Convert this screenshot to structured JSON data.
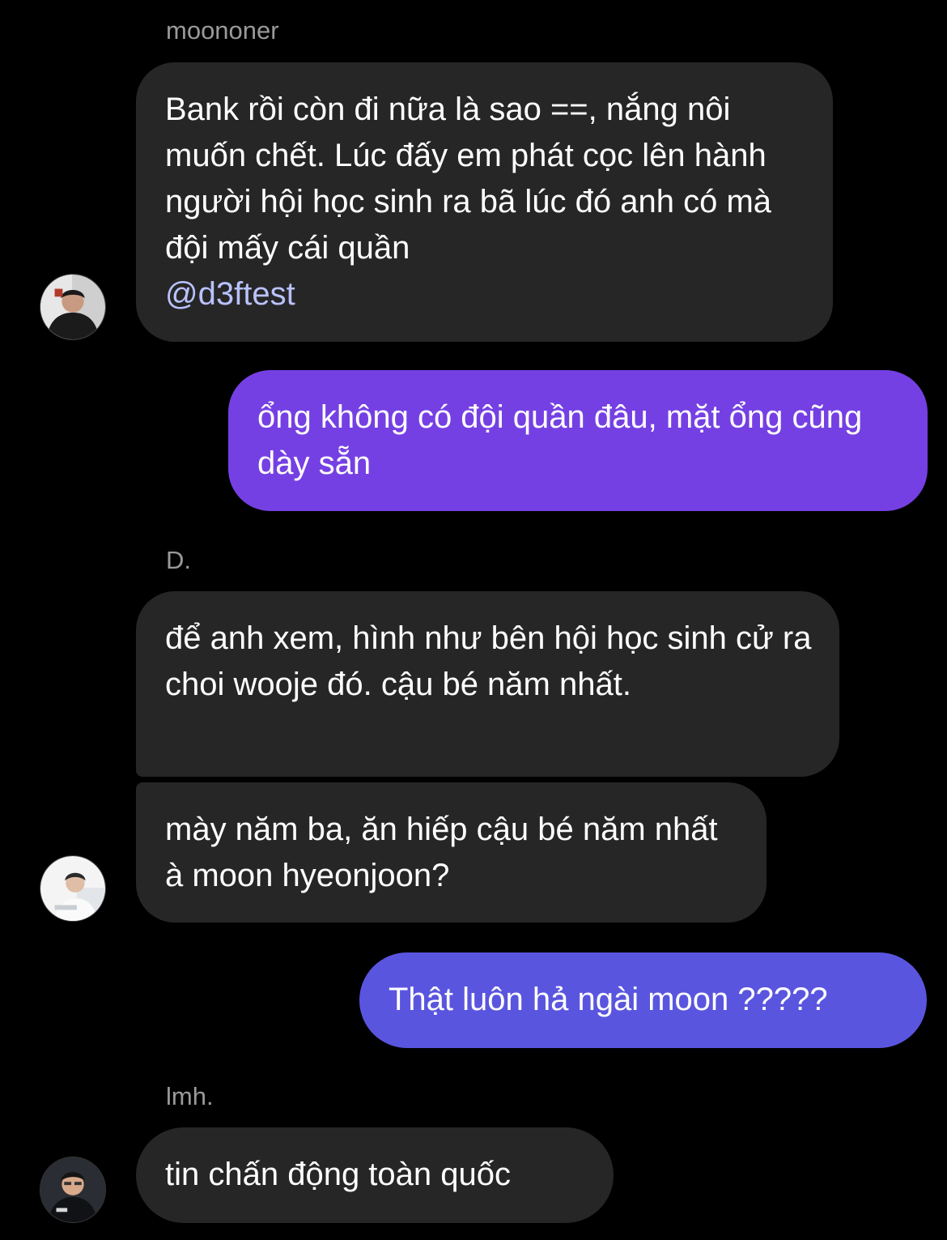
{
  "messages": [
    {
      "sender": "moononer",
      "text": "Bank rồi còn đi nữa là sao ==, nắng nôi muốn chết. Lúc đấy em phát cọc lên hành người hội học sinh ra bã lúc đó anh có mà đội mấy cái quần",
      "mention": "@d3ftest"
    },
    {
      "text": "ổng không có đội quần đâu, mặt ổng cũng dày sẵn"
    },
    {
      "sender": "D.",
      "text": "để anh xem, hình như bên hội học sinh cử ra choi wooje đó. cậu bé năm nhất."
    },
    {
      "text": "mày năm ba, ăn hiếp cậu bé năm nhất à moon hyeonjoon?"
    },
    {
      "text": "Thật luôn hả ngài moon ?????"
    },
    {
      "sender": "lmh.",
      "text": "tin chấn động toàn quốc"
    }
  ],
  "colors": {
    "background": "#000000",
    "incoming_bubble": "#262626",
    "outgoing_bubble_1": "#7540e3",
    "outgoing_bubble_2": "#5a55df",
    "sender_name": "#9a9a9a",
    "mention": "#b9c2ff"
  },
  "avatars": [
    "user-avatar-photo",
    "user-avatar-photo",
    "user-avatar-photo"
  ]
}
